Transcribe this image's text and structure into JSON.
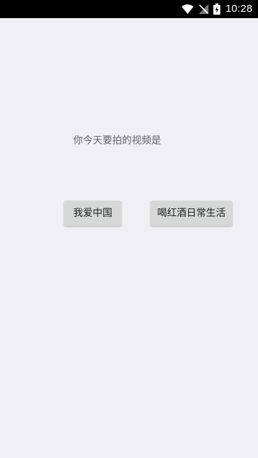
{
  "status_bar": {
    "time": "10:28",
    "icons": [
      "wifi-icon",
      "no-signal-icon",
      "battery-charging-icon"
    ]
  },
  "main": {
    "prompt_text": "你今天要拍的视频是",
    "buttons": [
      {
        "label": "我爱中国"
      },
      {
        "label": "喝红酒日常生活"
      }
    ]
  },
  "colors": {
    "background": "#efeff4",
    "status_bar": "#000000",
    "button_bg": "#d6d7d7",
    "prompt_text": "#666666"
  }
}
